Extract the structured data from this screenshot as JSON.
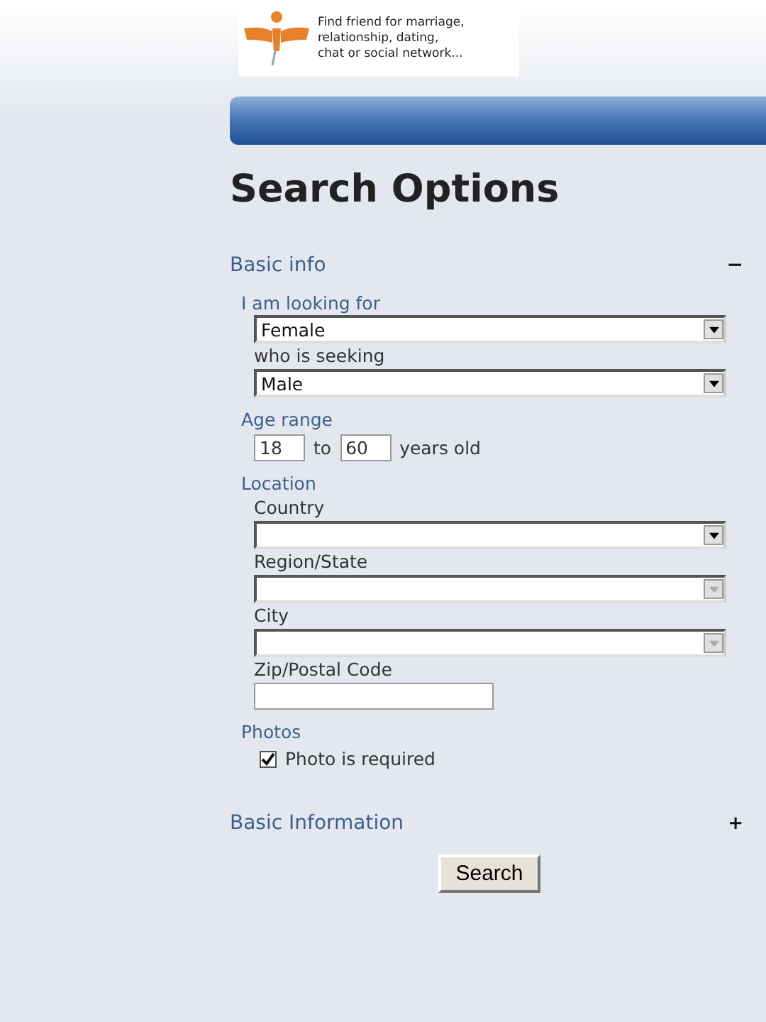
{
  "logo": {
    "tagline": [
      "Find friend for marriage,",
      "relationship, dating,",
      "chat or social network..."
    ]
  },
  "title": "Search Options",
  "sections": [
    {
      "title": "Basic info",
      "toggle": "−",
      "expanded": true,
      "groups": [
        {
          "label": "I am looking for",
          "items": [
            {
              "kind": "select",
              "value": "Female",
              "disabled": false
            },
            {
              "kind": "select",
              "label": "who is seeking",
              "value": "Male",
              "disabled": false
            }
          ]
        },
        {
          "label": "Age range",
          "items": [
            {
              "kind": "range",
              "from": "18",
              "sep": "to",
              "to": "60",
              "suffix": "years old"
            }
          ]
        },
        {
          "label": "Location",
          "items": [
            {
              "kind": "select",
              "label": "Country",
              "disabled": false
            },
            {
              "kind": "select",
              "label": "Region/State",
              "disabled": true
            },
            {
              "kind": "select",
              "label": "City",
              "disabled": true
            },
            {
              "kind": "text",
              "label": "Zip/Postal Code"
            }
          ]
        },
        {
          "label": "Photos",
          "items": [
            {
              "kind": "checkbox",
              "label": "Photo is required",
              "checked": true
            }
          ]
        }
      ]
    },
    {
      "title": "Basic Information",
      "toggle": "+",
      "expanded": false
    }
  ],
  "button": "Search"
}
